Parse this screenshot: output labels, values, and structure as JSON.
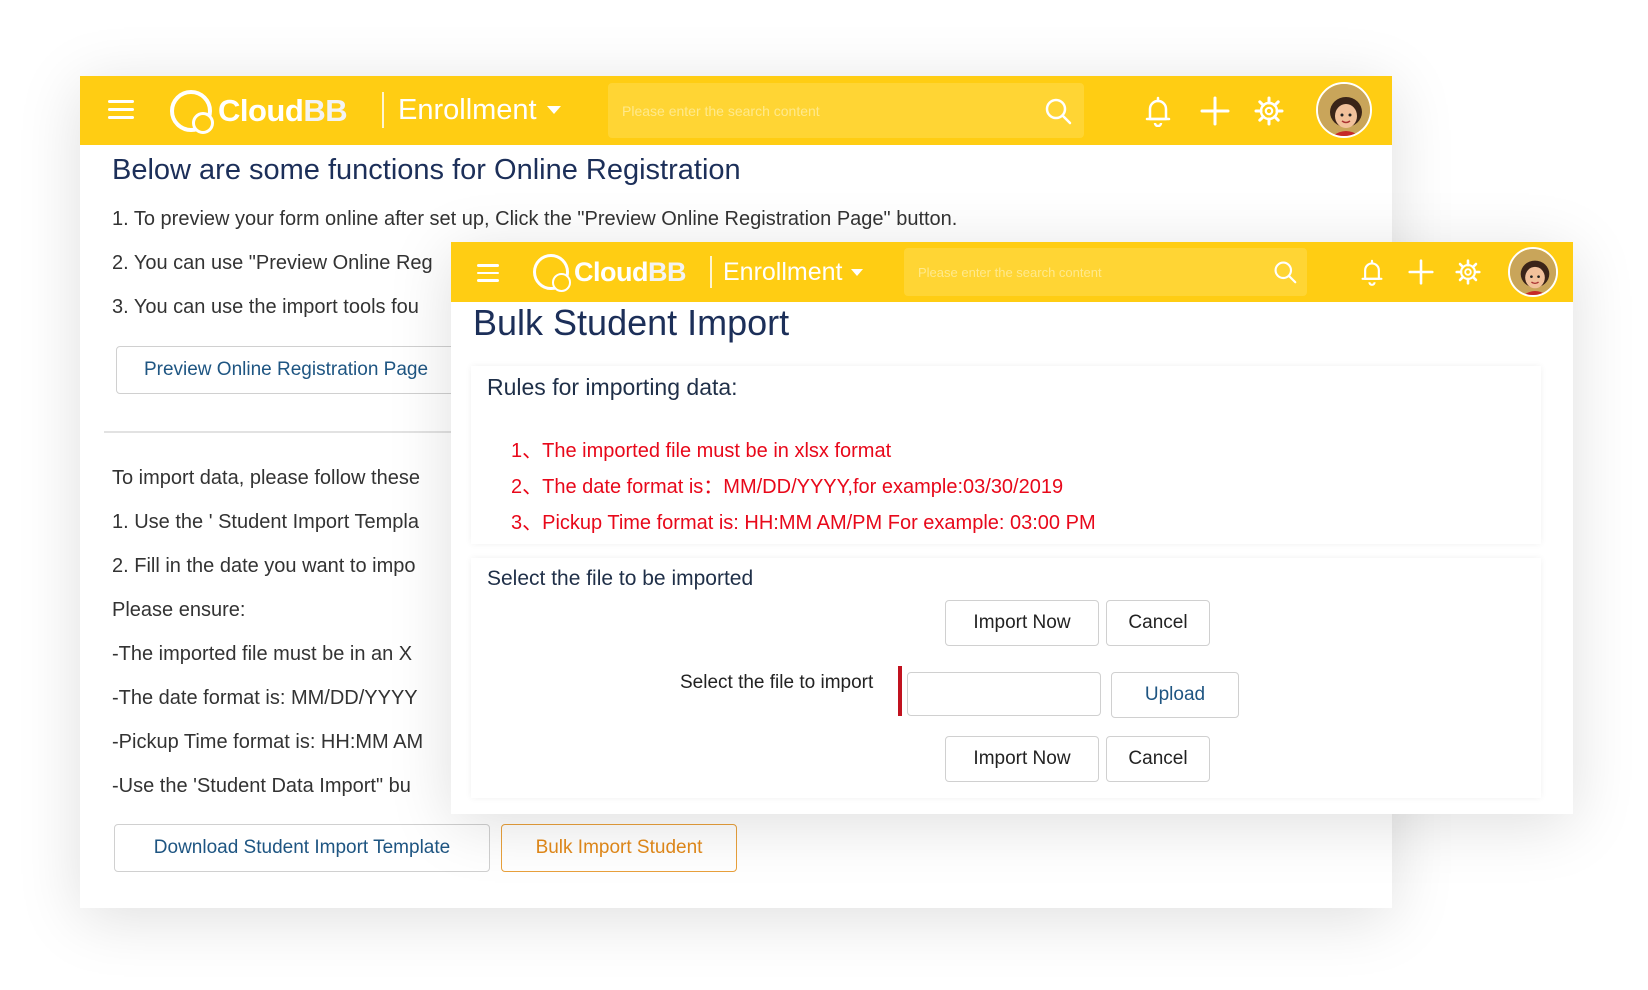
{
  "colors": {
    "accent": "#ffcd13",
    "title": "#1c2f59",
    "rule_red": "#e8081a",
    "orange_button": "#e38a1a",
    "link_blue": "#1e5582"
  },
  "brand": {
    "logo_cloud": "Cloud",
    "logo_bb": "BB"
  },
  "header": {
    "module": "Enrollment",
    "search_placeholder": "Please enter the search content",
    "icons": [
      "menu-icon",
      "search-icon",
      "bell-icon",
      "plus-icon",
      "gear-icon",
      "avatar"
    ]
  },
  "back_page": {
    "title": "Below are some functions for Online Registration",
    "lines": [
      "1. To preview your form online after set up, Click the \"Preview Online Registration Page\" button.",
      "2. You can use \"Preview Online Reg",
      "3. You can use the import tools fou"
    ],
    "preview_button": "Preview Online Registration Page",
    "import_intro": "To import data, please follow these",
    "import_steps": [
      "1. Use the ' Student Import Templa",
      "2. Fill in the date you want to impo",
      "Please ensure:",
      "-The imported file must be in an X",
      "-The date format is: MM/DD/YYYY",
      "-Pickup Time format is: HH:MM AM",
      "-Use the 'Student Data Import\" bu"
    ],
    "download_button": "Download Student Import Template",
    "bulk_button": "Bulk Import Student"
  },
  "front_page": {
    "title": "Bulk Student Import",
    "rules_heading": "Rules for importing data:",
    "rules": [
      "1、The imported file must be in xlsx format",
      "2、The date format is：MM/DD/YYYY,for example:03/30/2019",
      "3、Pickup Time format is: HH:MM AM/PM For example: 03:00 PM"
    ],
    "select_heading": "Select the file to be imported",
    "import_now": "Import Now",
    "cancel": "Cancel",
    "file_label": "Select the file to import",
    "file_value": "",
    "upload": "Upload"
  }
}
